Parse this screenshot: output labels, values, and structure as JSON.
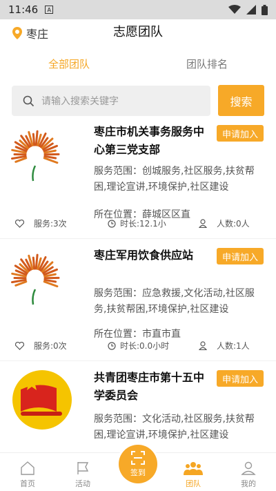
{
  "status_bar": {
    "time": "11:46",
    "a_icon": "A"
  },
  "header": {
    "location": "枣庄",
    "title": "志愿团队"
  },
  "tabs": [
    {
      "label": "全部团队",
      "active": true
    },
    {
      "label": "团队排名",
      "active": false
    }
  ],
  "search": {
    "placeholder": "请输入搜索关键字",
    "button": "搜索"
  },
  "teams": [
    {
      "name": "枣庄市机关事务服务中心第三党支部",
      "join": "申请加入",
      "scope": "服务范围：创城服务,社区服务,扶贫帮困,理论宣讲,环境保护,社区建设",
      "location": "所在位置：薛城区区直",
      "services": "服务:3次",
      "duration": "时长:12.1小",
      "members": "人数:0人"
    },
    {
      "name": "枣庄军用饮食供应站",
      "join": "申请加入",
      "scope": "服务范围：应急救援,文化活动,社区服务,扶贫帮困,环境保护,社区建设",
      "location": "所在位置：市直市直",
      "services": "服务:0次",
      "duration": "时长:0.0小时",
      "members": "人数:1人"
    },
    {
      "name": "共青团枣庄市第十五中学委员会",
      "join": "申请加入",
      "scope": "服务范围：文化活动,社区服务,扶贫帮困,理论宣讲,环境保护,社区建设"
    }
  ],
  "nav": {
    "home": "首页",
    "activity": "活动",
    "checkin": "签到",
    "team": "团队",
    "mine": "我的"
  },
  "colors": {
    "accent": "#f7a928"
  }
}
